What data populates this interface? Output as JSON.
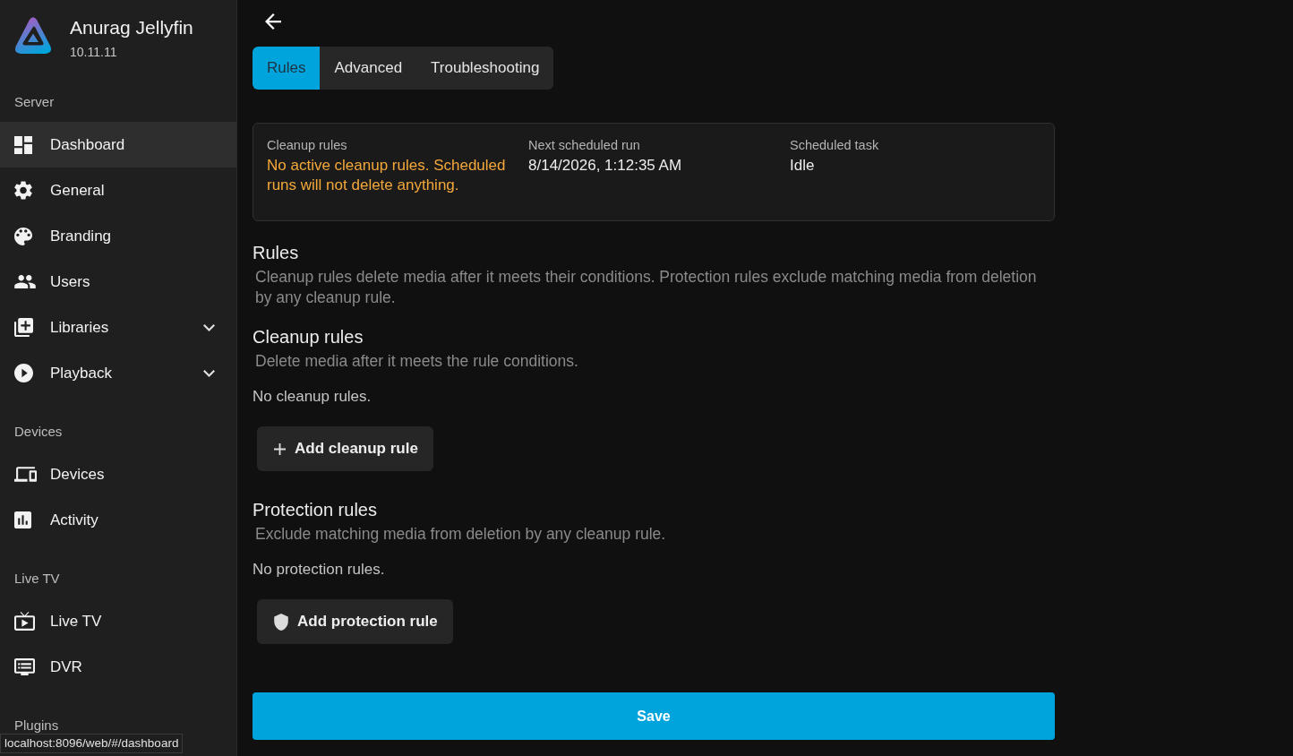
{
  "app": {
    "name": "Anurag Jellyfin",
    "version": "10.11.11"
  },
  "sidebar": {
    "sections": [
      {
        "title": "Server",
        "items": [
          {
            "label": "Dashboard",
            "kind": "link",
            "selected": true
          },
          {
            "label": "General",
            "kind": "link",
            "selected": false
          },
          {
            "label": "Branding",
            "kind": "link",
            "selected": false
          },
          {
            "label": "Users",
            "kind": "link",
            "selected": false
          },
          {
            "label": "Libraries",
            "kind": "group",
            "expanded": false,
            "selected": false
          },
          {
            "label": "Playback",
            "kind": "group",
            "expanded": false,
            "selected": false
          }
        ]
      },
      {
        "title": "Devices",
        "items": [
          {
            "label": "Devices",
            "kind": "link",
            "selected": false
          },
          {
            "label": "Activity",
            "kind": "link",
            "selected": false
          }
        ]
      },
      {
        "title": "Live TV",
        "items": [
          {
            "label": "Live TV",
            "kind": "link",
            "selected": false
          },
          {
            "label": "DVR",
            "kind": "link",
            "selected": false
          }
        ]
      },
      {
        "title": "Plugins"
      }
    ]
  },
  "tabs": [
    {
      "label": "Rules",
      "selected": true
    },
    {
      "label": "Advanced",
      "selected": false
    },
    {
      "label": "Troubleshooting",
      "selected": false
    }
  ],
  "summary": [
    {
      "label": "Cleanup rules",
      "value": "No active cleanup rules. Scheduled runs will not delete anything.",
      "kind": "warning"
    },
    {
      "label": "Next scheduled run",
      "value": "8/14/2026, 1:12:35 AM",
      "kind": "plain"
    },
    {
      "label": "Scheduled task",
      "value": "Idle",
      "kind": "plain"
    }
  ],
  "rules": {
    "title": "Rules",
    "description": "Cleanup rules delete media after it meets their conditions. Protection rules exclude matching media from deletion by any cleanup rule."
  },
  "rule_groups": [
    {
      "kind": "cleanup",
      "title": "Cleanup rules",
      "description": "Delete media after it meets the rule conditions.",
      "empty_text": "No cleanup rules.",
      "button": "Add cleanup rule"
    },
    {
      "kind": "protection",
      "title": "Protection rules",
      "description": "Exclude matching media from deletion by any cleanup rule.",
      "empty_text": "No protection rules.",
      "button": "Add protection rule"
    }
  ],
  "save_button": "Save",
  "status_bar": {
    "url": "localhost:8096/web/#/dashboard"
  }
}
